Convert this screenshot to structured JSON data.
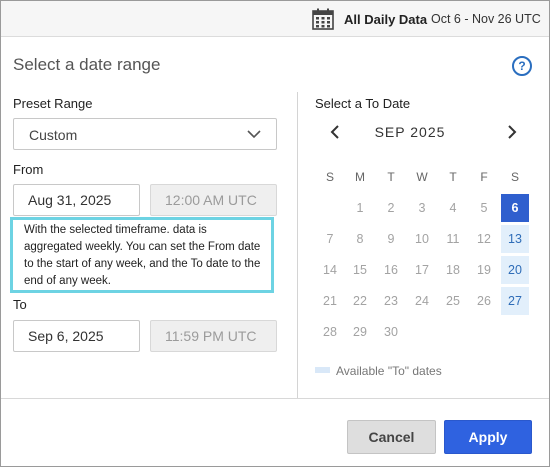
{
  "topbar": {
    "icon": "calendar-icon",
    "title": "All Daily Data",
    "range": "Oct 6 - Nov 26 UTC"
  },
  "dialog": {
    "title": "Select a date range",
    "help_icon": "question-icon",
    "help_glyph": "?"
  },
  "preset": {
    "label": "Preset Range",
    "value": "Custom"
  },
  "from": {
    "label": "From",
    "date": "Aug 31, 2025",
    "time": "12:00 AM UTC"
  },
  "tooltip": {
    "text": "With the selected timeframe. data is aggregated weekly. You can set the From date to the start of any week, and the To date to the end of any week."
  },
  "to": {
    "label": "To",
    "date": "Sep 6, 2025",
    "time": "11:59 PM UTC"
  },
  "calendar": {
    "label": "Select a To Date",
    "month": "SEP 2025",
    "prev_glyph": "‹",
    "next_glyph": "›",
    "weekdays": [
      "S",
      "M",
      "T",
      "W",
      "T",
      "F",
      "S"
    ],
    "weeks": [
      [
        "",
        "1",
        "2",
        "3",
        "4",
        "5",
        "6"
      ],
      [
        "7",
        "8",
        "9",
        "10",
        "11",
        "12",
        "13"
      ],
      [
        "14",
        "15",
        "16",
        "17",
        "18",
        "19",
        "20"
      ],
      [
        "21",
        "22",
        "23",
        "24",
        "25",
        "26",
        "27"
      ],
      [
        "28",
        "29",
        "30",
        "",
        "",
        "",
        ""
      ]
    ],
    "available": [
      "6",
      "13",
      "20",
      "27"
    ],
    "selected": "6",
    "legend": "Available \"To\" dates"
  },
  "footer": {
    "cancel": "Cancel",
    "apply": "Apply"
  },
  "colors": {
    "accent": "#2f62e0",
    "available_bg": "#e2effb",
    "tooltip_border": "#6dd3e3"
  }
}
